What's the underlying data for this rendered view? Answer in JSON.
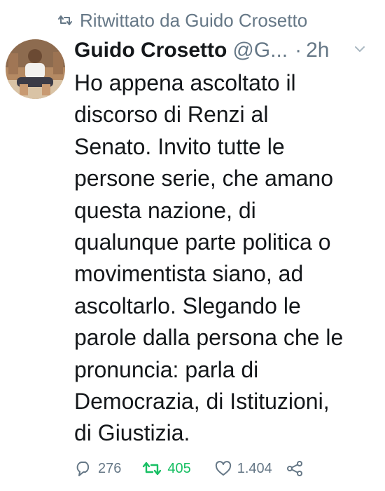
{
  "retweet_context": {
    "label": "Ritwittato da Guido Crosetto",
    "icon": "retweet-icon"
  },
  "author": {
    "display_name": "Guido Crosetto",
    "handle": "@G...",
    "separator": "·",
    "time": "2h"
  },
  "tweet": {
    "lines": [
      "Ho appena ascoltato il",
      "discorso di Renzi al",
      "Senato. Invito tutte le",
      "persone serie, che amano",
      "questa nazione, di",
      "qualunque parte politica o",
      "movimentista siano, ad",
      "ascoltarlo. Slegando le",
      "parole dalla persona che le",
      "pronuncia: parla di",
      "Democrazia, di Istituzioni,",
      "di Giustizia."
    ]
  },
  "actions": {
    "replies": "276",
    "retweets": "405",
    "likes": "1.404"
  },
  "colors": {
    "text": "#14171a",
    "secondary": "#657786",
    "retweet_active": "#17bf63"
  },
  "icons": [
    "retweet-icon",
    "chevron-down-icon",
    "reply-icon",
    "retweet-icon",
    "heart-icon",
    "share-icon"
  ]
}
